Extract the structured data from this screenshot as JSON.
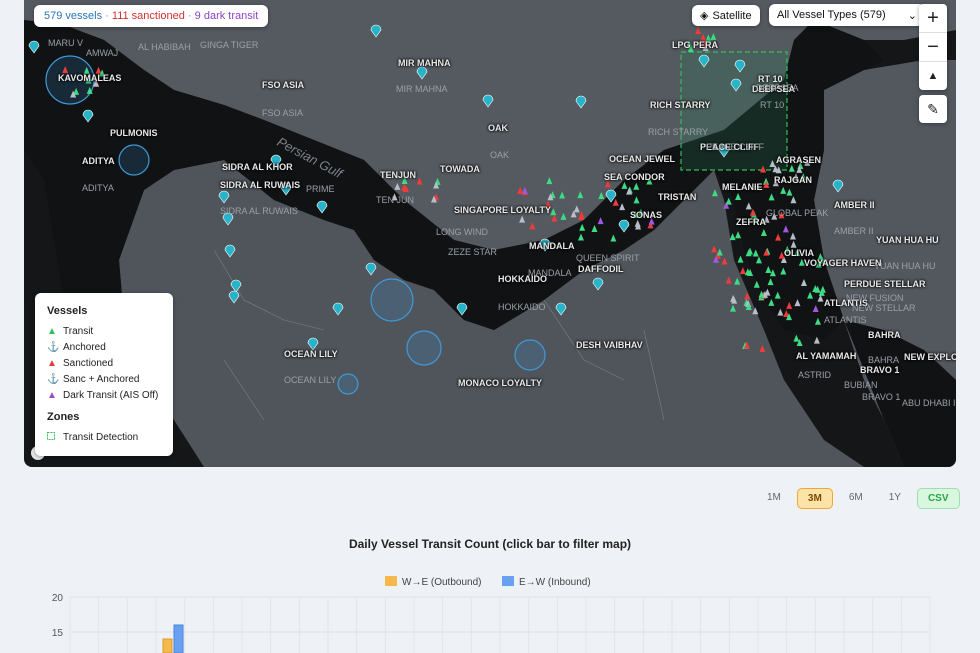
{
  "map": {
    "status": {
      "total": "579 vessels",
      "sanctioned": "111 sanctioned",
      "dark": "9 dark transit",
      "separator": "·"
    },
    "satellite_label": "Satellite",
    "vessel_type_filter": "All Vessel Types (579)",
    "zoom_in": "+",
    "zoom_out": "−",
    "compass": "▲",
    "draw_icon": "✎",
    "attribution_mark": "©",
    "labels_bold": [
      "KAVOMALEAS",
      "PULMONIS",
      "ADITYA",
      "SIDRA AL KHOR",
      "SIDRA AL RUWAIS",
      "MIR MAHNA",
      "FSO ASIA",
      "TENJUN",
      "TOWADA",
      "OAK",
      "RICH STARRY",
      "OCEAN JEWEL",
      "SEA CONDOR",
      "TRISTAN",
      "SINGAPORE LOYALTY",
      "SONAS",
      "MANDALA",
      "HOKKAIDO",
      "DAFFODIL",
      "OCEAN LILY",
      "DESH VAIBHAV",
      "MONACO LOYALTY",
      "MELANIE",
      "AGRASEN",
      "RAJGAN",
      "LPG PERA",
      "AMBER II",
      "YUAN HUA HU",
      "VOYAGER HAVEN",
      "PERDUE STELLAR",
      "ATLANTIS",
      "AL YAMAMAH",
      "BAHRA",
      "BRAVO 1",
      "NEW EXPLORER",
      "RT 10",
      "DEEPSEA",
      "PEACE CLIFF",
      "ZEFRA",
      "OLIVIA"
    ],
    "labels_plain": [
      "AL HABIBAH",
      "GINGA TIGER",
      "MIR MAHNA",
      "FSO ASIA",
      "OAK",
      "RICH STARRY",
      "TEN JUN",
      "LONG WIND",
      "ZEZE STAR",
      "MANDALA",
      "HOKKAIDO",
      "QUEEN SPIRIT",
      "OCEAN LILY",
      "ADITYA",
      "SIDRA AL RUWAIS",
      "MARU V",
      "AMWAJ",
      "PRIME",
      "GLOBAL PEAK",
      "AMBER II",
      "YUAN HUA HU",
      "NEW STELLAR",
      "ATLANTIS",
      "ASTRID",
      "BUBIAN",
      "BRAVO 1",
      "ABU DHABI III",
      "BAHRA",
      "RT 10",
      "DEEPSEA",
      "PEACE CLIFF",
      "NEW FUSION"
    ],
    "water_label": "Persian Gulf",
    "legend": {
      "vessels_title": "Vessels",
      "items": [
        {
          "label": "Transit",
          "symbol": "▲",
          "color": "#2fbf5a"
        },
        {
          "label": "Anchored",
          "symbol": "⚓",
          "color": "#8a93a6"
        },
        {
          "label": "Sanctioned",
          "symbol": "▲",
          "color": "#e53935"
        },
        {
          "label": "Sanc + Anchored",
          "symbol": "⚓",
          "color": "#e53935"
        },
        {
          "label": "Dark Transit (AIS Off)",
          "symbol": "▲",
          "color": "#9b4dca"
        }
      ],
      "zones_title": "Zones",
      "zone_items": [
        {
          "label": "Transit Detection",
          "color": "#2fbf5a"
        }
      ]
    }
  },
  "range": {
    "options": [
      "1M",
      "3M",
      "6M",
      "1Y"
    ],
    "active": "3M",
    "csv": "CSV"
  },
  "chart_data": {
    "type": "bar",
    "title": "Daily Vessel Transit Count (click bar to filter map)",
    "series": [
      {
        "name": "W→E (Outbound)",
        "color": "#f5b84a",
        "values": [
          14
        ]
      },
      {
        "name": "E→W (Inbound)",
        "color": "#6aa0f0",
        "values": [
          16
        ]
      }
    ],
    "yticks": [
      "20",
      "15"
    ],
    "ylim": [
      0,
      20
    ]
  }
}
